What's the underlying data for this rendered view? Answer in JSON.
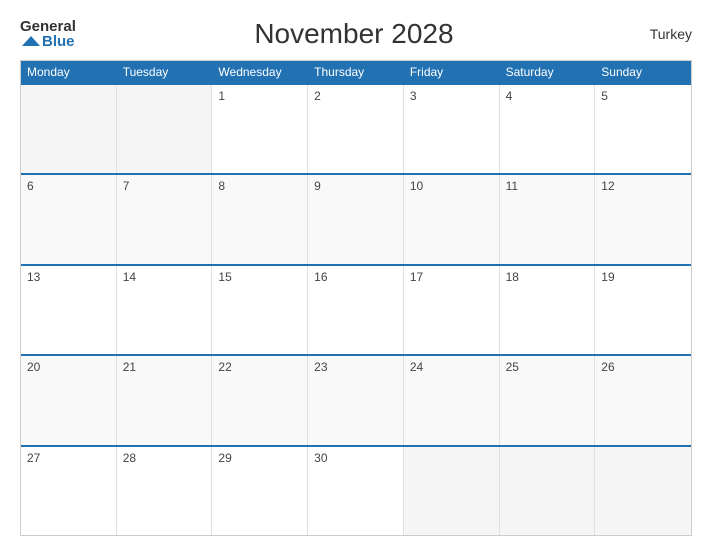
{
  "header": {
    "title": "November 2028",
    "country": "Turkey",
    "logo_general": "General",
    "logo_blue": "Blue"
  },
  "days": [
    "Monday",
    "Tuesday",
    "Wednesday",
    "Thursday",
    "Friday",
    "Saturday",
    "Sunday"
  ],
  "weeks": [
    [
      {
        "date": "",
        "empty": true
      },
      {
        "date": "",
        "empty": true
      },
      {
        "date": "1",
        "empty": false
      },
      {
        "date": "2",
        "empty": false
      },
      {
        "date": "3",
        "empty": false
      },
      {
        "date": "4",
        "empty": false
      },
      {
        "date": "5",
        "empty": false
      }
    ],
    [
      {
        "date": "6",
        "empty": false
      },
      {
        "date": "7",
        "empty": false
      },
      {
        "date": "8",
        "empty": false
      },
      {
        "date": "9",
        "empty": false
      },
      {
        "date": "10",
        "empty": false
      },
      {
        "date": "11",
        "empty": false
      },
      {
        "date": "12",
        "empty": false
      }
    ],
    [
      {
        "date": "13",
        "empty": false
      },
      {
        "date": "14",
        "empty": false
      },
      {
        "date": "15",
        "empty": false
      },
      {
        "date": "16",
        "empty": false
      },
      {
        "date": "17",
        "empty": false
      },
      {
        "date": "18",
        "empty": false
      },
      {
        "date": "19",
        "empty": false
      }
    ],
    [
      {
        "date": "20",
        "empty": false
      },
      {
        "date": "21",
        "empty": false
      },
      {
        "date": "22",
        "empty": false
      },
      {
        "date": "23",
        "empty": false
      },
      {
        "date": "24",
        "empty": false
      },
      {
        "date": "25",
        "empty": false
      },
      {
        "date": "26",
        "empty": false
      }
    ],
    [
      {
        "date": "27",
        "empty": false
      },
      {
        "date": "28",
        "empty": false
      },
      {
        "date": "29",
        "empty": false
      },
      {
        "date": "30",
        "empty": false
      },
      {
        "date": "",
        "empty": true
      },
      {
        "date": "",
        "empty": true
      },
      {
        "date": "",
        "empty": true
      }
    ]
  ]
}
